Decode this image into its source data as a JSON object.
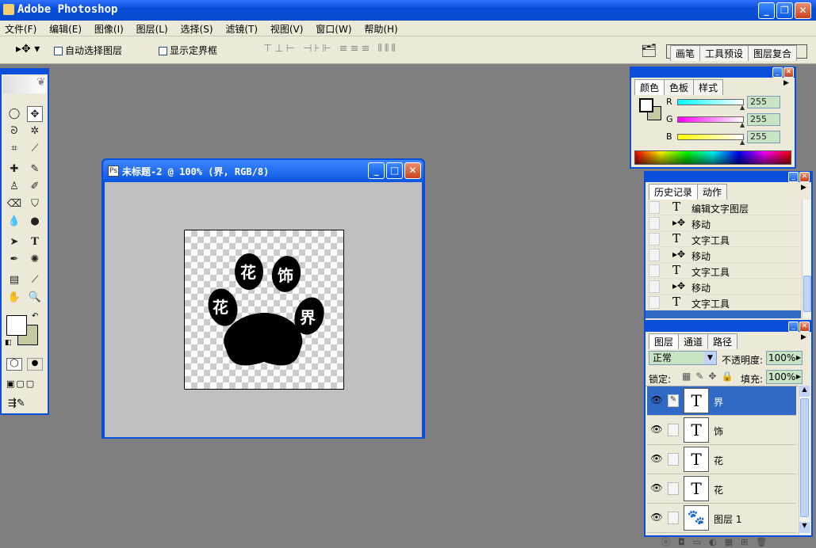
{
  "app": {
    "title": "Adobe Photoshop"
  },
  "menu": [
    "文件(F)",
    "编辑(E)",
    "图像(I)",
    "图层(L)",
    "选择(S)",
    "滤镜(T)",
    "视图(V)",
    "窗口(W)",
    "帮助(H)"
  ],
  "options": {
    "auto_select": "自动选择图层",
    "show_bounds": "显示定界框",
    "palette_tabs": [
      "画笔",
      "工具预设",
      "图层复合"
    ]
  },
  "document": {
    "title": "未标题-2 @ 100% (界, RGB/8)",
    "glyphs": [
      "花",
      "饰",
      "花",
      "界"
    ]
  },
  "color_panel": {
    "tabs": [
      "颜色",
      "色板",
      "样式"
    ],
    "channels": [
      {
        "label": "R",
        "value": "255"
      },
      {
        "label": "G",
        "value": "255"
      },
      {
        "label": "B",
        "value": "255"
      }
    ]
  },
  "history_panel": {
    "tabs": [
      "历史记录",
      "动作"
    ],
    "items": [
      {
        "icon": "T",
        "label": "编辑文字图层"
      },
      {
        "icon": "move",
        "label": "移动"
      },
      {
        "icon": "T",
        "label": "文字工具"
      },
      {
        "icon": "move",
        "label": "移动"
      },
      {
        "icon": "T",
        "label": "文字工具"
      },
      {
        "icon": "move",
        "label": "移动"
      },
      {
        "icon": "T",
        "label": "文字工具"
      }
    ]
  },
  "layers_panel": {
    "tabs": [
      "图层",
      "通道",
      "路径"
    ],
    "blend_mode": "正常",
    "opacity_label": "不透明度:",
    "opacity": "100%",
    "lock_label": "锁定:",
    "fill_label": "填充:",
    "fill": "100%",
    "layers": [
      {
        "name": "界",
        "selected": true
      },
      {
        "name": "饰"
      },
      {
        "name": "花"
      },
      {
        "name": "花"
      },
      {
        "name": "图层 1",
        "image": true
      }
    ]
  }
}
